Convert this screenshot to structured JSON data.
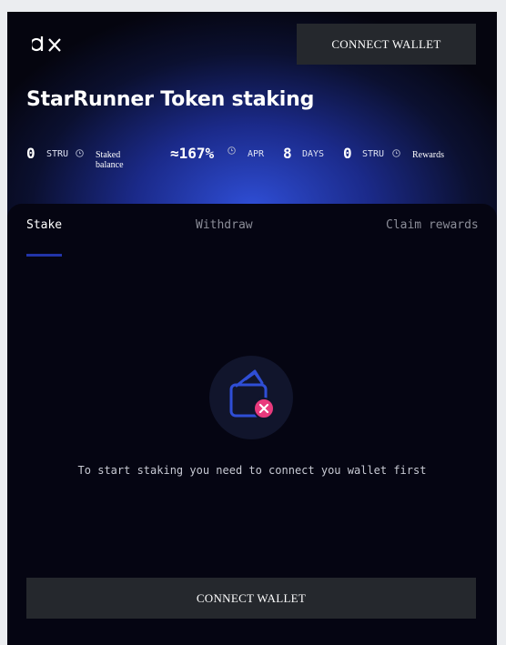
{
  "header": {
    "connect_label": "CONNECT WALLET",
    "title": "StarRunner Token staking"
  },
  "stats": {
    "staked_value": "0",
    "staked_unit": "STRU",
    "staked_caption": "Staked balance",
    "apr_value": "≈167%",
    "apr_label": "APR",
    "lock_value": "8",
    "lock_unit": "DAYS",
    "rewards_value": "0",
    "rewards_unit": "STRU",
    "rewards_caption": "Rewards"
  },
  "tabs": [
    {
      "label": "Stake",
      "active": true
    },
    {
      "label": "Withdraw",
      "active": false
    },
    {
      "label": "Claim rewards",
      "active": false
    }
  ],
  "empty_state": {
    "message": "To start staking you need to connect you wallet first",
    "icon": "wallet-disconnected-icon"
  },
  "footer": {
    "connect_label": "CONNECT WALLET"
  },
  "colors": {
    "accent_blue": "#2f4ed6",
    "tab_underline": "#2234a8",
    "error_pink": "#e93a7d",
    "button_bg": "#25282d"
  }
}
